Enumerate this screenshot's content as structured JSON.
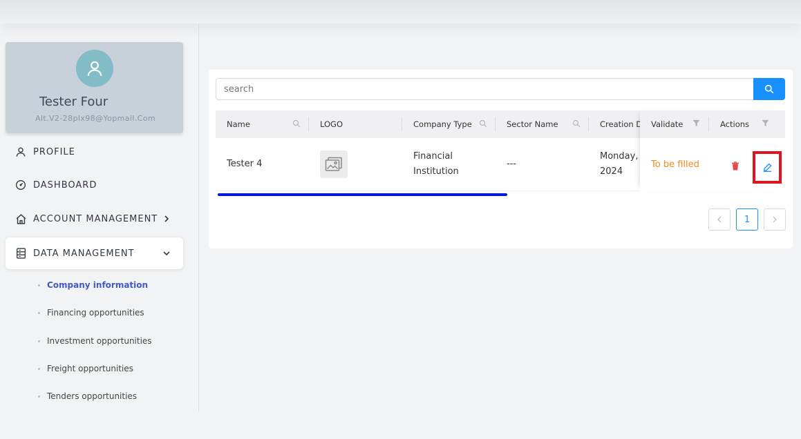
{
  "profile": {
    "name": "Tester Four",
    "email": "Alt.V2-28plx98@Yopmail.Com"
  },
  "nav": {
    "profile": "PROFILE",
    "dashboard": "DASHBOARD",
    "account_management": "ACCOUNT MANAGEMENT",
    "data_management": "DATA MANAGEMENT"
  },
  "submenu": [
    "Company information",
    "Financing opportunities",
    "Investment opportunities",
    "Freight opportunities",
    "Tenders opportunities"
  ],
  "search": {
    "placeholder": "search"
  },
  "table": {
    "headers": {
      "name": "Name",
      "logo": "LOGO",
      "company_type": "Company Type",
      "sector_name": "Sector Name",
      "creation_date": "Creation Dat",
      "validate": "Validate",
      "actions": "Actions"
    },
    "rows": [
      {
        "name": "Tester 4",
        "company_type_line1": "Financial",
        "company_type_line2": "Institution",
        "sector_name": "---",
        "creation_date_line1": "Monday, Ap",
        "creation_date_line2": "2024",
        "validate": "To be filled"
      }
    ]
  },
  "pagination": {
    "current_page": "1"
  },
  "colors": {
    "primary": "#1890ff",
    "active_menu": "#4259c0",
    "validate_status": "#f08a1c",
    "delete_icon": "#e04848",
    "highlight_box": "#e0141e"
  }
}
